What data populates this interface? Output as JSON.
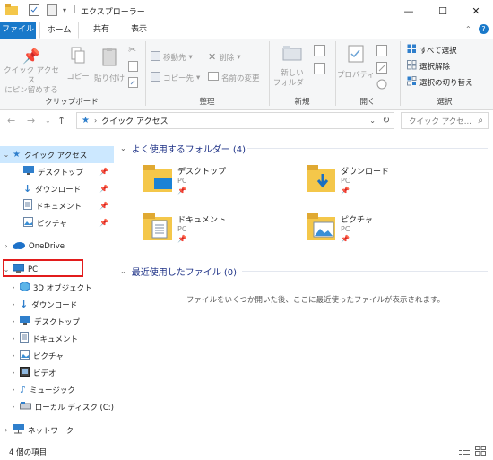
{
  "window": {
    "title": "エクスプローラー",
    "minimize": "—",
    "maximize": "☐",
    "close": "✕"
  },
  "ribbon_tabs": [
    "ファイル",
    "ホーム",
    "共有",
    "表示"
  ],
  "ribbon": {
    "clipboard": {
      "pin_quick_access": [
        "クイック アクセス",
        "にピン留めする"
      ],
      "copy": "コピー",
      "paste": "貼り付け",
      "label": "クリップボード"
    },
    "organize": {
      "move_to": "移動先",
      "copy_to": "コピー先",
      "delete": "削除",
      "rename": "名前の変更",
      "label": "整理"
    },
    "new": {
      "new_folder": [
        "新しい",
        "フォルダー"
      ],
      "label": "新規"
    },
    "open": {
      "properties": "プロパティ",
      "label": "開く"
    },
    "select": {
      "select_all": "すべて選択",
      "select_none": "選択解除",
      "invert_selection": "選択の切り替え",
      "label": "選択"
    }
  },
  "address": {
    "path": "クイック アクセス",
    "search_placeholder": "クイック アクセ..."
  },
  "nav_pane": {
    "quick_access": "クイック アクセス",
    "quick_items": [
      "デスクトップ",
      "ダウンロード",
      "ドキュメント",
      "ピクチャ"
    ],
    "onedrive": "OneDrive",
    "pc": "PC",
    "pc_items": [
      "3D オブジェクト",
      "ダウンロード",
      "デスクトップ",
      "ドキュメント",
      "ピクチャ",
      "ビデオ",
      "ミュージック",
      "ローカル ディスク (C:)"
    ],
    "network": "ネットワーク"
  },
  "content": {
    "frequent_header": "よく使用するフォルダー (4)",
    "folders": [
      {
        "name": "デスクトップ",
        "location": "PC"
      },
      {
        "name": "ダウンロード",
        "location": "PC"
      },
      {
        "name": "ドキュメント",
        "location": "PC"
      },
      {
        "name": "ピクチャ",
        "location": "PC"
      }
    ],
    "recent_header": "最近使用したファイル (0)",
    "recent_empty": "ファイルをいくつか開いた後、ここに最近使ったファイルが表示されます。"
  },
  "status": {
    "item_count": "4 個の項目"
  },
  "colors": {
    "accent": "#1979ca",
    "selection": "#cce8ff",
    "highlight_box": "#e21c1c",
    "section_header": "#1e3287"
  }
}
